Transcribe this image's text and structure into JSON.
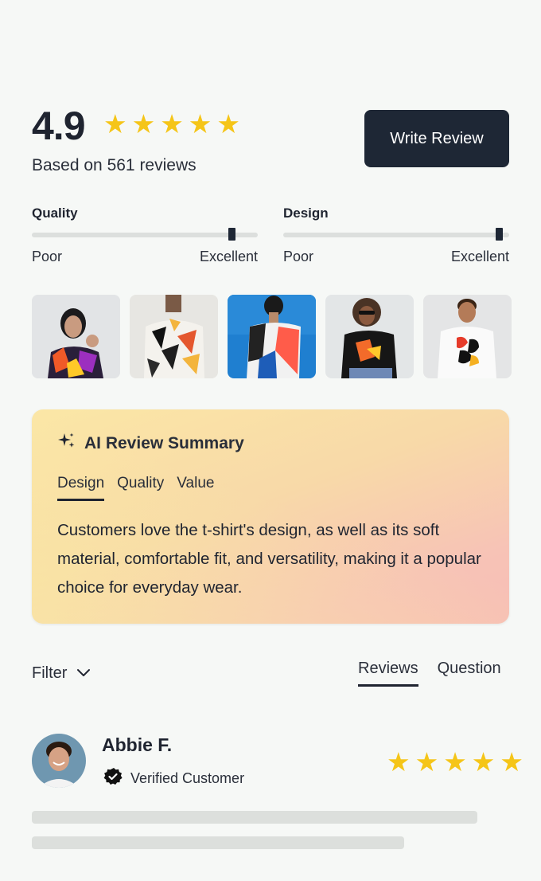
{
  "summary": {
    "rating": "4.9",
    "stars": 5,
    "based_on": "Based on 561 reviews",
    "write_review_label": "Write Review"
  },
  "metrics": [
    {
      "title": "Quality",
      "low": "Poor",
      "high": "Excellent",
      "value": 0.9
    },
    {
      "title": "Design",
      "low": "Poor",
      "high": "Excellent",
      "value": 0.9
    }
  ],
  "gallery": [
    {
      "alt": "Woman in colorful t-shirt"
    },
    {
      "alt": "Man in geometric print t-shirt"
    },
    {
      "alt": "Man in color-block t-shirt on blue background"
    },
    {
      "alt": "Woman in black graphic t-shirt"
    },
    {
      "alt": "Man in white abstract print t-shirt"
    }
  ],
  "ai_summary": {
    "title": "AI Review Summary",
    "tabs": [
      "Design",
      "Quality",
      "Value"
    ],
    "active_tab": "Design",
    "text": "Customers love the t-shirt's design, as well as its soft material, comfortable fit, and versatility, making it a popular choice for everyday wear."
  },
  "filter": {
    "label": "Filter"
  },
  "list_tabs": [
    "Reviews",
    "Question"
  ],
  "review": {
    "name": "Abbie F.",
    "badge": "Verified Customer",
    "stars": 5
  },
  "colors": {
    "star": "#f5c518",
    "button_bg": "#1e2735",
    "card_gradient_start": "#fbe7a6",
    "card_gradient_end": "#f7bdb6"
  }
}
